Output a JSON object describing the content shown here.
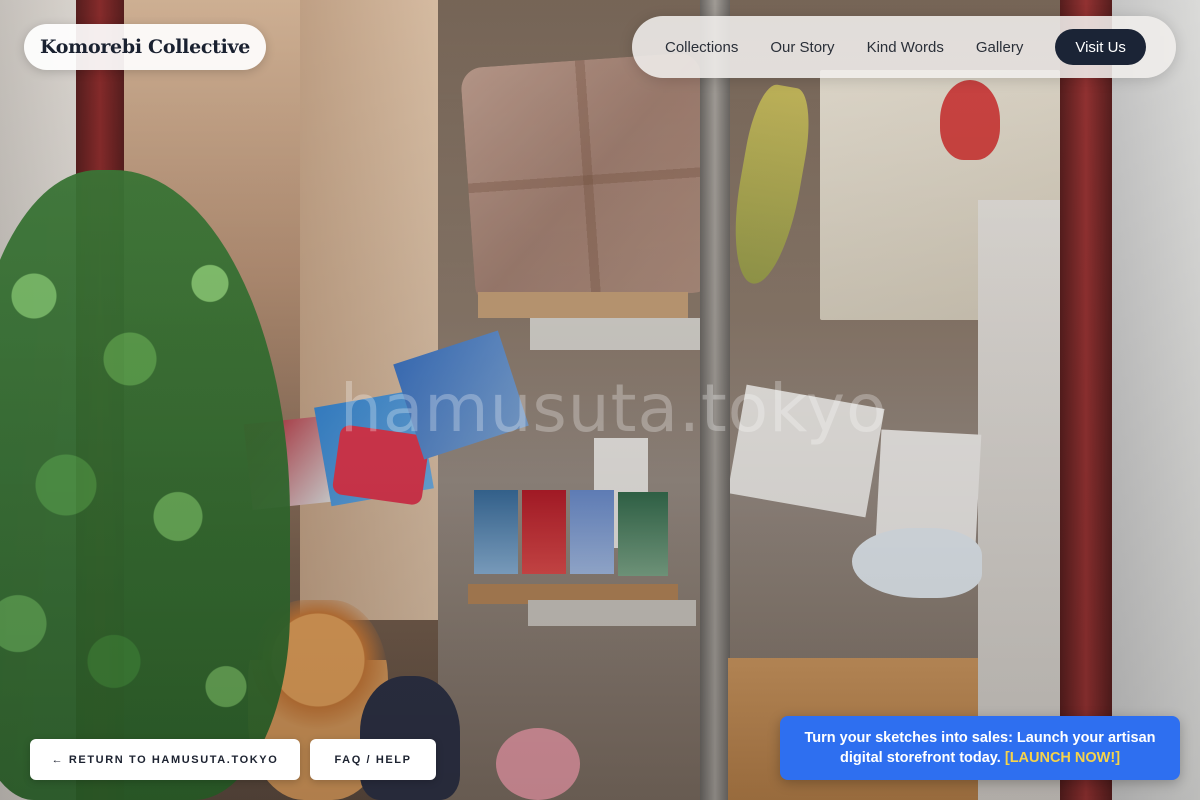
{
  "brand": {
    "name": "Komorebi Collective"
  },
  "nav": {
    "links": [
      "Collections",
      "Our Story",
      "Kind Words",
      "Gallery"
    ],
    "cta": "Visit Us"
  },
  "background": {
    "watermark": "hamusuta.tokyo"
  },
  "footer": {
    "back_label": "← RETURN TO HAMUSUTA.TOKYO",
    "faq_label": "FAQ / HELP"
  },
  "promo": {
    "text": "Turn your sketches into sales: Launch your artisan digital storefront today.",
    "link": "[LAUNCH NOW!]"
  },
  "colors": {
    "promo_bg": "#2e6ff0",
    "promo_link": "#f6d34a",
    "cta_bg": "#1b2436"
  }
}
